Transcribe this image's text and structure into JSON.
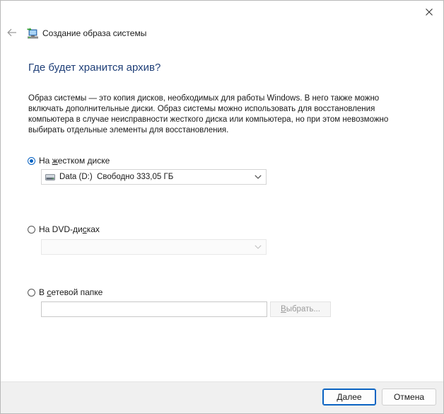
{
  "window": {
    "title": "Создание образа системы"
  },
  "icons": {
    "close": "close-icon",
    "back": "back-arrow-icon",
    "app": "system-image-backup-icon",
    "drive": "hard-drive-icon",
    "dropdown": "chevron-down-icon"
  },
  "colors": {
    "heading": "#1f3f78",
    "accent": "#0a63c2",
    "footer_bg": "#f0f0f0"
  },
  "page": {
    "heading": "Где будет хранится архив?",
    "description": "Образ системы — это копия дисков, необходимых для работы Windows. В него также можно включать дополнительные диски. Образ системы можно использовать для восстановления компьютера в случае неисправности жесткого диска или компьютера, но при этом невозможно выбирать отдельные элементы для восстановления."
  },
  "options": {
    "hard_disk": {
      "label_pre": "На ",
      "label_accel": "ж",
      "label_post": "естком диске",
      "selected": true,
      "drive_label": "Data (D:)",
      "free_space": "Свободно 333,05 ГБ"
    },
    "dvd": {
      "label_pre": "На DVD-ди",
      "label_accel": "с",
      "label_post": "ках",
      "selected": false,
      "value": ""
    },
    "network": {
      "label_pre": "В ",
      "label_accel": "с",
      "label_post": "етевой папке",
      "selected": false,
      "path_value": "",
      "browse_label_accel": "В",
      "browse_label_rest": "ыбрать..."
    }
  },
  "footer": {
    "next_accel": "Д",
    "next_rest": "алее",
    "cancel_label": "Отмена"
  }
}
